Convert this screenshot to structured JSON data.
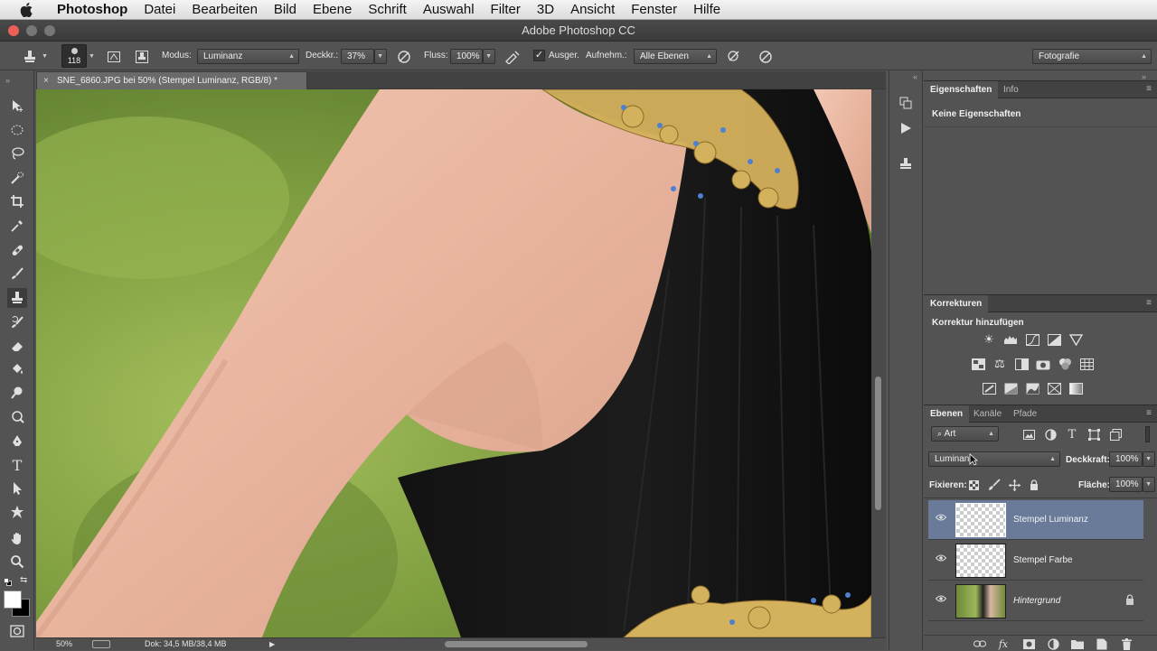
{
  "menubar": {
    "apple_icon": "apple-logo-icon",
    "items": [
      "Photoshop",
      "Datei",
      "Bearbeiten",
      "Bild",
      "Ebene",
      "Schrift",
      "Auswahl",
      "Filter",
      "3D",
      "Ansicht",
      "Fenster",
      "Hilfe"
    ]
  },
  "window": {
    "title": "Adobe Photoshop CC"
  },
  "options": {
    "brush_size": "118",
    "mode_label": "Modus:",
    "mode_value": "Luminanz",
    "opacity_label": "Deckkr.:",
    "opacity_value": "37%",
    "flow_label": "Fluss:",
    "flow_value": "100%",
    "aligned_label": "Ausger.",
    "sample_label": "Aufnehm.:",
    "sample_value": "Alle Ebenen",
    "workspace_value": "Fotografie"
  },
  "document": {
    "tab_title": "SNE_6860.JPG bei 50% (Stempel Luminanz, RGB/8) *",
    "zoom": "50%",
    "doc_info": "Dok: 34,5 MB/38,4 MB"
  },
  "properties_panel": {
    "tabs": [
      "Eigenschaften",
      "Info"
    ],
    "content": "Keine Eigenschaften"
  },
  "adjustments_panel": {
    "tab": "Korrekturen",
    "heading": "Korrektur hinzufügen"
  },
  "layers_panel": {
    "tabs": [
      "Ebenen",
      "Kanäle",
      "Pfade"
    ],
    "filter_value": "Art",
    "blend_mode": "Luminanz",
    "opacity_label": "Deckkraft:",
    "opacity_value": "100%",
    "lock_label": "Fixieren:",
    "fill_label": "Fläche:",
    "fill_value": "100%",
    "layers": [
      {
        "name": "Stempel Luminanz",
        "selected": true
      },
      {
        "name": "Stempel Farbe",
        "selected": false
      },
      {
        "name": "Hintergrund",
        "selected": false
      }
    ]
  },
  "colors": {
    "accent_selected_layer": "#6a7b99",
    "panel_bg": "#535353",
    "foreground_color": "#ffffff",
    "background_color": "#000000"
  }
}
